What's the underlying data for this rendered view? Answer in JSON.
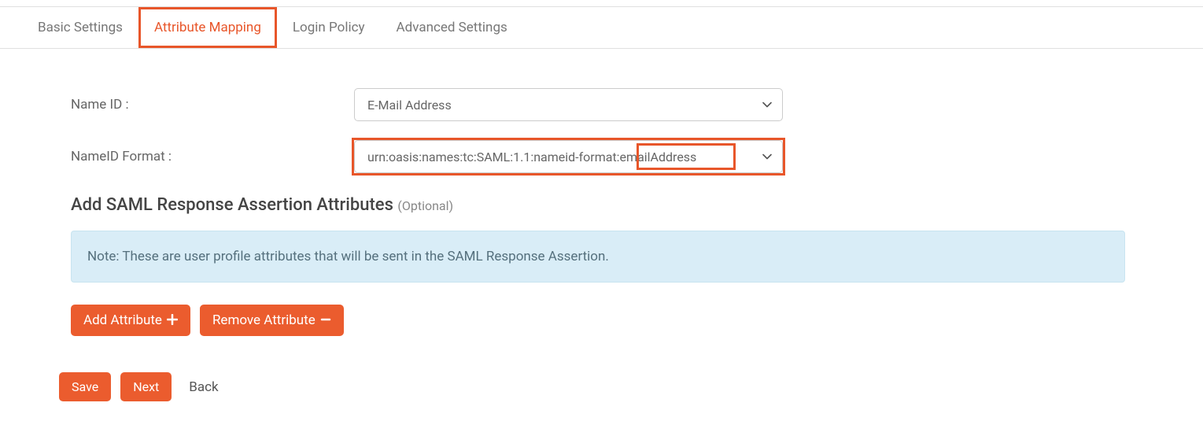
{
  "tabs": {
    "basic": "Basic Settings",
    "attribute": "Attribute Mapping",
    "login": "Login Policy",
    "advanced": "Advanced Settings"
  },
  "form": {
    "nameid_label": "Name ID :",
    "nameid_value": "E-Mail Address",
    "nameid_format_label": "NameID Format :",
    "nameid_format_value": "urn:oasis:names:tc:SAML:1.1:nameid-format:emailAddress"
  },
  "section": {
    "title": "Add SAML Response Assertion Attributes ",
    "optional": "(Optional)"
  },
  "note": "Note: These are user profile attributes that will be sent in the SAML Response Assertion.",
  "buttons": {
    "add_attribute": "Add Attribute",
    "remove_attribute": "Remove Attribute",
    "save": "Save",
    "next": "Next",
    "back": "Back"
  }
}
